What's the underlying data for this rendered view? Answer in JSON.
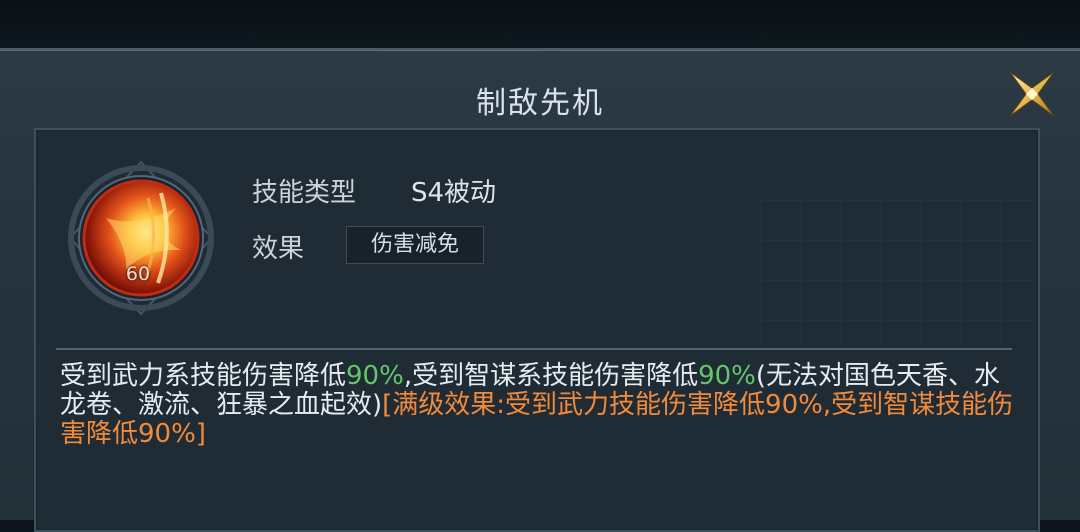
{
  "dialog": {
    "title": "制敌先机"
  },
  "skill": {
    "level": "60",
    "type_label": "技能类型",
    "type_value": "S4被动",
    "effect_label": "效果",
    "effect_tag": "伤害减免"
  },
  "description": {
    "seg1": "受到武力系技能伤害降低",
    "pct1": "90%",
    "seg2": ",受到智谋系技能伤害降低",
    "pct2": "90%",
    "seg3": "(无法对国色天香、水龙卷、激流、狂暴之血起效)",
    "max_level": "[满级效果:受到武力技能伤害降低90%,受到智谋技能伤害降低90%]"
  },
  "icons": {
    "close": "close-x-icon",
    "skill": "skill-flame-icon"
  },
  "colors": {
    "highlight_green": "#66c46a",
    "max_level_orange": "#f28a3a",
    "title": "#d9e2ea"
  }
}
